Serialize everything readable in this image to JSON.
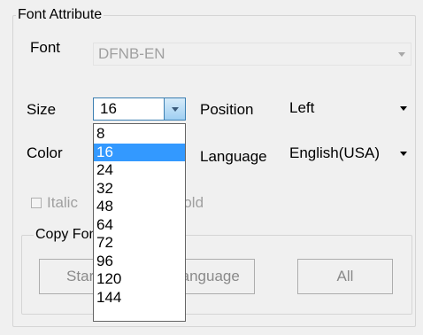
{
  "font_attribute": {
    "legend": "Font Attribute",
    "font_label": "Font",
    "font_value": "DFNB-EN",
    "size_label": "Size",
    "size_value": "16",
    "position_label": "Position",
    "position_value": "Left",
    "color_label": "Color",
    "language_label": "Language",
    "language_value": "English(USA)",
    "italic_label": "Italic",
    "bold_label": "Bold"
  },
  "size_dropdown": {
    "selected": "16",
    "options": [
      "8",
      "16",
      "24",
      "32",
      "48",
      "64",
      "72",
      "96",
      "120",
      "144"
    ]
  },
  "copy_group": {
    "legend": "Copy Font Setup",
    "buttons": [
      "Start",
      "Language",
      "All"
    ]
  },
  "colors": {
    "selection": "#3399ff",
    "group_border": "#d5d5d5",
    "disabled_text": "#a0a0a0"
  }
}
